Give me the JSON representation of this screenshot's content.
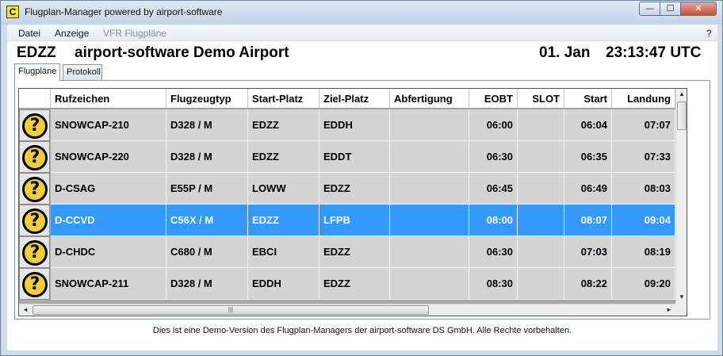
{
  "window": {
    "title": "Flugplan-Manager powered by airport-software",
    "app_icon_letter": "C",
    "min_glyph": "—",
    "max_glyph": "☐",
    "close_glyph": "✕"
  },
  "menu": {
    "items": [
      "Datei",
      "Anzeige",
      "VFR Flugpläne"
    ],
    "help": "?"
  },
  "airport": {
    "icao": "EDZZ",
    "name": "airport-software Demo Airport",
    "date": "01. Jan",
    "time": "23:13:47 UTC"
  },
  "tabs": [
    {
      "label": "Flugpläne",
      "active": true
    },
    {
      "label": "Protokoll",
      "active": false
    }
  ],
  "table": {
    "columns": [
      "Rufzeichen",
      "Flugzeugtyp",
      "Start-Platz",
      "Ziel-Platz",
      "Abfertigung",
      "EOBT",
      "SLOT",
      "Start",
      "Landung"
    ],
    "status_icon": "question-icon",
    "status_glyph": "?",
    "selected_row": 3,
    "rows": [
      [
        "SNOWCAP-210",
        "D328 / M",
        "EDZZ",
        "EDDH",
        "",
        "06:00",
        "",
        "06:04",
        "07:07"
      ],
      [
        "SNOWCAP-220",
        "D328 / M",
        "EDZZ",
        "EDDT",
        "",
        "06:30",
        "",
        "06:35",
        "07:33"
      ],
      [
        "D-CSAG",
        "E55P / M",
        "LOWW",
        "EDZZ",
        "",
        "06:45",
        "",
        "06:49",
        "08:03"
      ],
      [
        "D-CCVD",
        "C56X / M",
        "EDZZ",
        "LFPB",
        "",
        "08:00",
        "",
        "08:07",
        "09:04"
      ],
      [
        "D-CHDC",
        "C680 / M",
        "EBCI",
        "EDZZ",
        "",
        "06:30",
        "",
        "07:03",
        "08:19"
      ],
      [
        "SNOWCAP-211",
        "D328 / M",
        "EDDH",
        "EDZZ",
        "",
        "08:30",
        "",
        "08:22",
        "09:20"
      ]
    ]
  },
  "scrollbars": {
    "up": "▲",
    "down": "▼",
    "left": "◄",
    "right": "►",
    "grip": "|||"
  },
  "footer": "Dies ist eine Demo-Version des Flugplan-Managers der airport-software DS GmbH. Alle Rechte vorbehalten."
}
